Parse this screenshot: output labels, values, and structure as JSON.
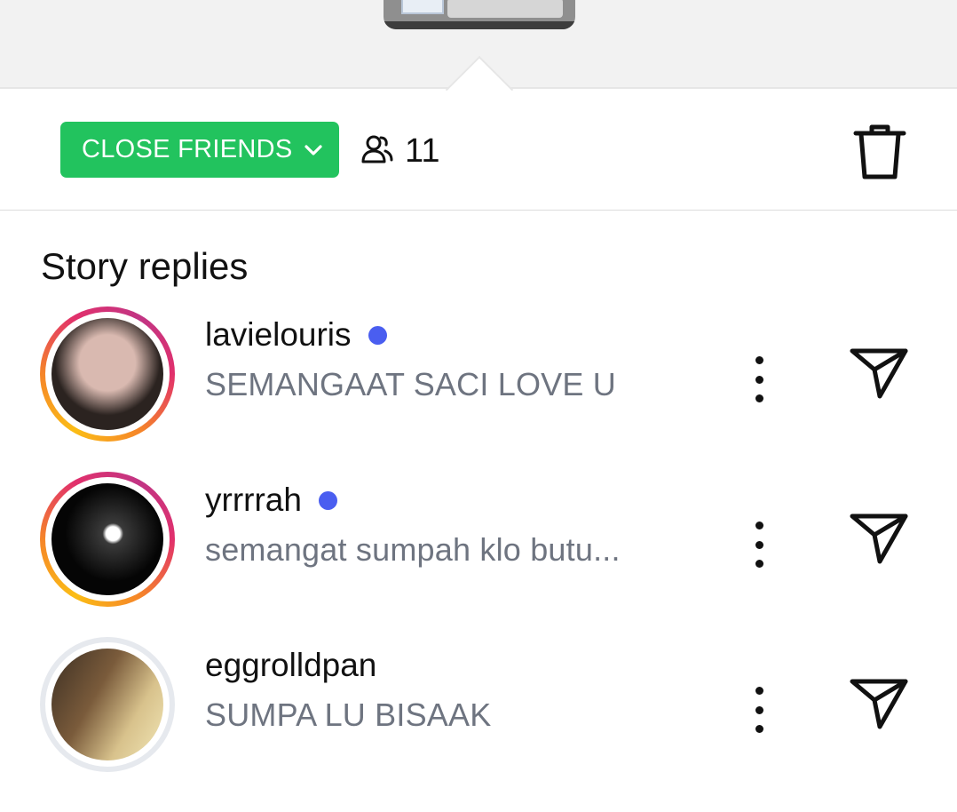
{
  "toolbar": {
    "audience_label": "CLOSE FRIENDS",
    "viewer_count": "11",
    "icons": {
      "chevron": "chevron-down-icon",
      "viewers": "people-icon",
      "delete": "trash-icon"
    }
  },
  "section": {
    "title": "Story replies"
  },
  "replies": [
    {
      "username": "lavielouris",
      "unread": true,
      "message": "SEMANGAAT SACI LOVE U",
      "ring": "gradient"
    },
    {
      "username": "yrrrrah",
      "unread": true,
      "message": "semangat sumpah klo butu...",
      "ring": "gradient"
    },
    {
      "username": "eggrolldpan",
      "unread": false,
      "message": "SUMPA LU BISAAK",
      "ring": "plain"
    }
  ],
  "colors": {
    "accent_green": "#22c35e",
    "unread_dot": "#4a5ef0",
    "secondary_text": "#6e7480"
  }
}
